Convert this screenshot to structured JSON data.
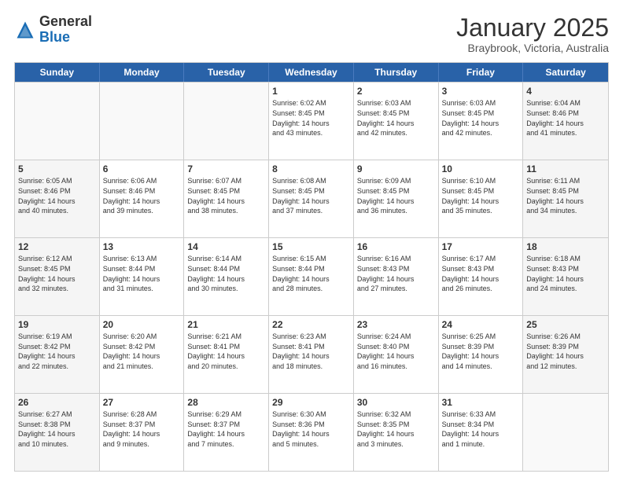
{
  "header": {
    "logo_general": "General",
    "logo_blue": "Blue",
    "month_title": "January 2025",
    "location": "Braybrook, Victoria, Australia"
  },
  "days_of_week": [
    "Sunday",
    "Monday",
    "Tuesday",
    "Wednesday",
    "Thursday",
    "Friday",
    "Saturday"
  ],
  "rows": [
    [
      {
        "day": "",
        "info": "",
        "empty": true
      },
      {
        "day": "",
        "info": "",
        "empty": true
      },
      {
        "day": "",
        "info": "",
        "empty": true
      },
      {
        "day": "1",
        "info": "Sunrise: 6:02 AM\nSunset: 8:45 PM\nDaylight: 14 hours\nand 43 minutes."
      },
      {
        "day": "2",
        "info": "Sunrise: 6:03 AM\nSunset: 8:45 PM\nDaylight: 14 hours\nand 42 minutes."
      },
      {
        "day": "3",
        "info": "Sunrise: 6:03 AM\nSunset: 8:45 PM\nDaylight: 14 hours\nand 42 minutes."
      },
      {
        "day": "4",
        "info": "Sunrise: 6:04 AM\nSunset: 8:46 PM\nDaylight: 14 hours\nand 41 minutes.",
        "shaded": true
      }
    ],
    [
      {
        "day": "5",
        "info": "Sunrise: 6:05 AM\nSunset: 8:46 PM\nDaylight: 14 hours\nand 40 minutes.",
        "shaded": true
      },
      {
        "day": "6",
        "info": "Sunrise: 6:06 AM\nSunset: 8:46 PM\nDaylight: 14 hours\nand 39 minutes."
      },
      {
        "day": "7",
        "info": "Sunrise: 6:07 AM\nSunset: 8:45 PM\nDaylight: 14 hours\nand 38 minutes."
      },
      {
        "day": "8",
        "info": "Sunrise: 6:08 AM\nSunset: 8:45 PM\nDaylight: 14 hours\nand 37 minutes."
      },
      {
        "day": "9",
        "info": "Sunrise: 6:09 AM\nSunset: 8:45 PM\nDaylight: 14 hours\nand 36 minutes."
      },
      {
        "day": "10",
        "info": "Sunrise: 6:10 AM\nSunset: 8:45 PM\nDaylight: 14 hours\nand 35 minutes."
      },
      {
        "day": "11",
        "info": "Sunrise: 6:11 AM\nSunset: 8:45 PM\nDaylight: 14 hours\nand 34 minutes.",
        "shaded": true
      }
    ],
    [
      {
        "day": "12",
        "info": "Sunrise: 6:12 AM\nSunset: 8:45 PM\nDaylight: 14 hours\nand 32 minutes.",
        "shaded": true
      },
      {
        "day": "13",
        "info": "Sunrise: 6:13 AM\nSunset: 8:44 PM\nDaylight: 14 hours\nand 31 minutes."
      },
      {
        "day": "14",
        "info": "Sunrise: 6:14 AM\nSunset: 8:44 PM\nDaylight: 14 hours\nand 30 minutes."
      },
      {
        "day": "15",
        "info": "Sunrise: 6:15 AM\nSunset: 8:44 PM\nDaylight: 14 hours\nand 28 minutes."
      },
      {
        "day": "16",
        "info": "Sunrise: 6:16 AM\nSunset: 8:43 PM\nDaylight: 14 hours\nand 27 minutes."
      },
      {
        "day": "17",
        "info": "Sunrise: 6:17 AM\nSunset: 8:43 PM\nDaylight: 14 hours\nand 26 minutes."
      },
      {
        "day": "18",
        "info": "Sunrise: 6:18 AM\nSunset: 8:43 PM\nDaylight: 14 hours\nand 24 minutes.",
        "shaded": true
      }
    ],
    [
      {
        "day": "19",
        "info": "Sunrise: 6:19 AM\nSunset: 8:42 PM\nDaylight: 14 hours\nand 22 minutes.",
        "shaded": true
      },
      {
        "day": "20",
        "info": "Sunrise: 6:20 AM\nSunset: 8:42 PM\nDaylight: 14 hours\nand 21 minutes."
      },
      {
        "day": "21",
        "info": "Sunrise: 6:21 AM\nSunset: 8:41 PM\nDaylight: 14 hours\nand 20 minutes."
      },
      {
        "day": "22",
        "info": "Sunrise: 6:23 AM\nSunset: 8:41 PM\nDaylight: 14 hours\nand 18 minutes."
      },
      {
        "day": "23",
        "info": "Sunrise: 6:24 AM\nSunset: 8:40 PM\nDaylight: 14 hours\nand 16 minutes."
      },
      {
        "day": "24",
        "info": "Sunrise: 6:25 AM\nSunset: 8:39 PM\nDaylight: 14 hours\nand 14 minutes."
      },
      {
        "day": "25",
        "info": "Sunrise: 6:26 AM\nSunset: 8:39 PM\nDaylight: 14 hours\nand 12 minutes.",
        "shaded": true
      }
    ],
    [
      {
        "day": "26",
        "info": "Sunrise: 6:27 AM\nSunset: 8:38 PM\nDaylight: 14 hours\nand 10 minutes.",
        "shaded": true
      },
      {
        "day": "27",
        "info": "Sunrise: 6:28 AM\nSunset: 8:37 PM\nDaylight: 14 hours\nand 9 minutes."
      },
      {
        "day": "28",
        "info": "Sunrise: 6:29 AM\nSunset: 8:37 PM\nDaylight: 14 hours\nand 7 minutes."
      },
      {
        "day": "29",
        "info": "Sunrise: 6:30 AM\nSunset: 8:36 PM\nDaylight: 14 hours\nand 5 minutes."
      },
      {
        "day": "30",
        "info": "Sunrise: 6:32 AM\nSunset: 8:35 PM\nDaylight: 14 hours\nand 3 minutes."
      },
      {
        "day": "31",
        "info": "Sunrise: 6:33 AM\nSunset: 8:34 PM\nDaylight: 14 hours\nand 1 minute."
      },
      {
        "day": "",
        "info": "",
        "empty": true
      }
    ]
  ]
}
